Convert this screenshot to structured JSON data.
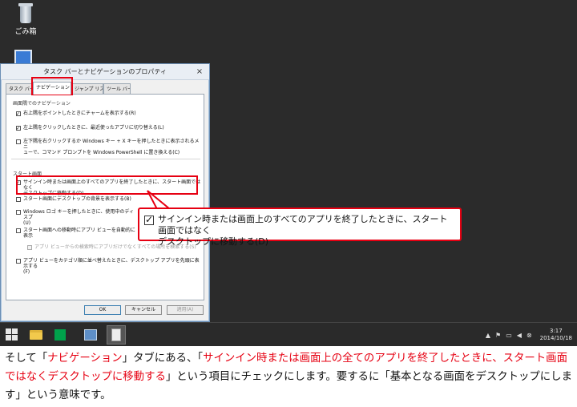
{
  "desktop": {
    "recycle_bin_label": "ごみ箱"
  },
  "dialog": {
    "title": "タスク バーとナビゲーションのプロパティ",
    "close_glyph": "×",
    "tabs": [
      {
        "label": "タスク バー"
      },
      {
        "label": "ナビゲーション"
      },
      {
        "label": "ジャンプ リスト"
      },
      {
        "label": "ツール バー"
      }
    ],
    "corner_nav_group": "画面隅でのナビゲーション",
    "corner_options": [
      {
        "label": "右上隅をポイントしたときにチャームを表示する(R)",
        "checked": true
      },
      {
        "label": "左上隅をクリックしたときに、最近使ったアプリに切り替える(L)",
        "checked": true
      },
      {
        "label_line1": "左下隅を右クリックするか Windows キー + X キーを押したときに表示されるメニ",
        "label_line2": "ューで、コマンド プロンプトを Windows PowerShell に置き換える(C)",
        "checked": false
      }
    ],
    "start_screen_group": "スタート画面",
    "start_options": [
      {
        "label_line1": "サインイン時または画面上のすべてのアプリを終了したときに、スタート画面ではなく",
        "label_line2": "デスクトップに移動する(D)",
        "checked": true
      },
      {
        "label": "スタート画面にデスクトップの背景を表示する(B)",
        "checked": false
      },
      {
        "label_line1": "Windows ロゴ キーを押したときに、使用中のディスプ",
        "label_line2": "(U)",
        "checked": false
      },
      {
        "label": "スタート画面への移動時にアプリ ビューを自動的に表示",
        "checked": false
      },
      {
        "label": "アプリ ビューからの検索時にアプリだけでなくすべての場所を検索する(S)",
        "checked": false,
        "disabled": true
      },
      {
        "label_line1": "アプリ ビューをカテゴリ順に並べ替えたときに、デスクトップ アプリを先頭に表示する",
        "label_line2": "(F)",
        "checked": false
      }
    ],
    "buttons": {
      "ok": "OK",
      "cancel": "キャンセル",
      "apply": "適用(A)"
    }
  },
  "callout": {
    "line1": "サインイン時または画面上のすべてのアプリを終了したときに、スタート画面ではなく",
    "line2": "デスクトップに移動する(D)"
  },
  "taskbar": {
    "time": "3:17",
    "date": "2014/10/18"
  },
  "caption": {
    "p1": "そして「",
    "h1": "ナビゲーション",
    "p2": "」タブにある、「",
    "h2": "サインイン時または画面上の全てのアプリを終了したときに、スタート画面ではなくデスクトップに移動する",
    "p3": "」という項目にチェックにします。要するに「基本となる画面をデスクトップにします」という意味です。"
  },
  "colors": {
    "highlight": "#e60012",
    "desktop_bg": "#2b2b2b",
    "taskbar_bg": "#2a2a2a"
  }
}
